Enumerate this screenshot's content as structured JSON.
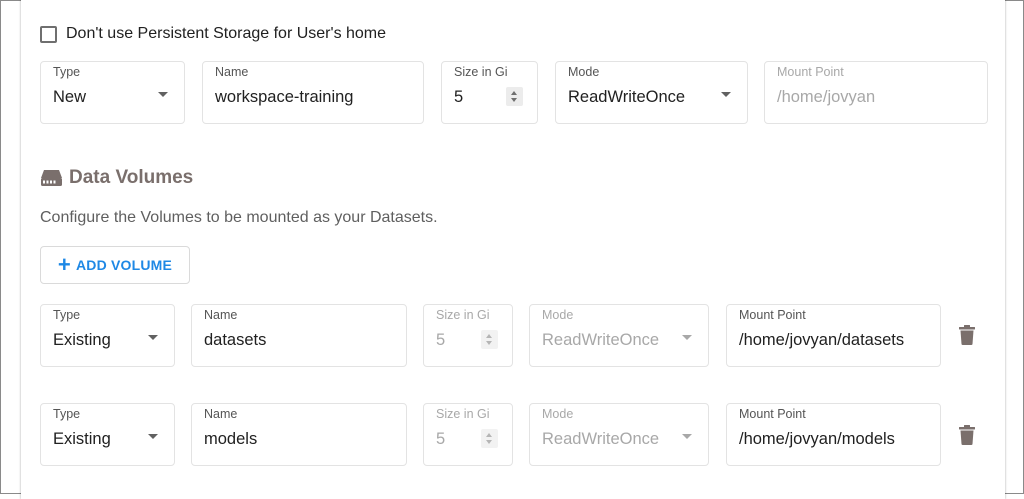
{
  "persistent_storage": {
    "checkbox_label": "Don't use Persistent Storage for User's home",
    "checked": false
  },
  "workspace": {
    "type": {
      "label": "Type",
      "value": "New"
    },
    "name": {
      "label": "Name",
      "value": "workspace-training"
    },
    "size": {
      "label": "Size in Gi",
      "value": "5"
    },
    "mode": {
      "label": "Mode",
      "value": "ReadWriteOnce"
    },
    "mount": {
      "label": "Mount Point",
      "value": "/home/jovyan"
    }
  },
  "data_volumes": {
    "title": "Data Volumes",
    "icon": "hard-drive-icon",
    "description": "Configure the Volumes to be mounted as your Datasets.",
    "add_button_label": "ADD VOLUME",
    "volumes": [
      {
        "type": {
          "label": "Type",
          "value": "Existing"
        },
        "name": {
          "label": "Name",
          "value": "datasets"
        },
        "size": {
          "label": "Size in Gi",
          "value": "5"
        },
        "mode": {
          "label": "Mode",
          "value": "ReadWriteOnce"
        },
        "mount": {
          "label": "Mount Point",
          "value": "/home/jovyan/datasets"
        }
      },
      {
        "type": {
          "label": "Type",
          "value": "Existing"
        },
        "name": {
          "label": "Name",
          "value": "models"
        },
        "size": {
          "label": "Size in Gi",
          "value": "5"
        },
        "mode": {
          "label": "Mode",
          "value": "ReadWriteOnce"
        },
        "mount": {
          "label": "Mount Point",
          "value": "/home/jovyan/models"
        }
      }
    ]
  },
  "colors": {
    "accent": "#1e88e5",
    "section_title": "#7a6f6c",
    "trash_icon": "#7a6f6c",
    "disabled_text": "#a8a8a8"
  }
}
